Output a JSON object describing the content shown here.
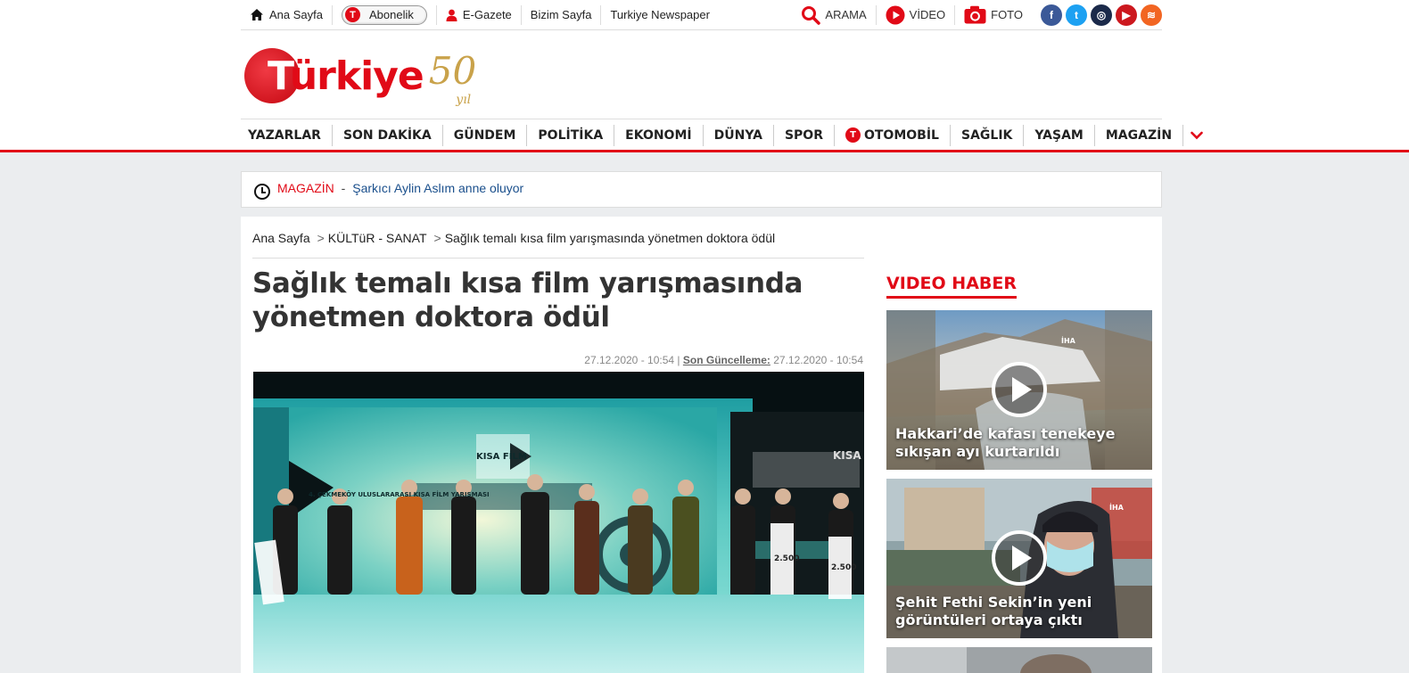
{
  "topbar": {
    "home": "Ana Sayfa",
    "abonelik": "Abonelik",
    "egazete": "E-Gazete",
    "bizim_sayfa": "Bizim Sayfa",
    "turkiye_newspaper": "Turkiye Newspaper",
    "arama": "ARAMA",
    "video": "VİDEO",
    "foto": "FOTO",
    "social": [
      {
        "icon": "facebook-icon",
        "glyph": "f",
        "color": "#3b5998"
      },
      {
        "icon": "twitter-icon",
        "glyph": "t",
        "color": "#1da1f2"
      },
      {
        "icon": "instagram-icon",
        "glyph": "◎",
        "color": "#1b2a4a"
      },
      {
        "icon": "youtube-icon",
        "glyph": "▶",
        "color": "#cc181e"
      },
      {
        "icon": "rss-icon",
        "glyph": "≋",
        "color": "#f26522"
      }
    ]
  },
  "logo": {
    "text_start": "T",
    "text_rest": "ürkiye",
    "anniversary": "50",
    "yil": "yıl"
  },
  "nav": {
    "items": [
      "YAZARLAR",
      "SON DAKİKA",
      "GÜNDEM",
      "POLİTİKA",
      "EKONOMİ",
      "DÜNYA",
      "SPOR",
      "OTOMOBİL",
      "SAĞLIK",
      "YAŞAM",
      "MAGAZİN"
    ],
    "more": "⌄"
  },
  "ticker": {
    "category": "MAGAZİN",
    "separator": "-",
    "text": "Şarkıcı Aylin Aslım anne oluyor"
  },
  "breadcrumb": {
    "home": "Ana Sayfa",
    "sep": ">",
    "section": "KÜLTüR - SANAT",
    "current": "Sağlık temalı kısa film yarışmasında yönetmen doktora ödül"
  },
  "article": {
    "title": "Sağlık temalı kısa film yarışmasında yönetmen doktora ödül",
    "published": "27.12.2020 - 10:54",
    "updated_label": "Son Güncelleme:",
    "updated": "27.12.2020 - 10:54",
    "image_banner": "4. ÇEKMEKÖY ULUSLARARASI KISA FİLM YARIŞMASI",
    "image_screen": "KISA FİLM",
    "prize": "2.500"
  },
  "sidebar": {
    "title": "VIDEO HABER",
    "videos": [
      {
        "caption": "Hakkari’de kafası tenekeye sıkışan ayı kurtarıldı"
      },
      {
        "caption": "Şehit Fethi Sekin’in yeni görüntüleri ortaya çıktı"
      }
    ],
    "iha_label": "İHA"
  },
  "colors": {
    "brand": "#e10a17",
    "link": "#1a4f8c",
    "gray_bg": "#ebedef"
  }
}
